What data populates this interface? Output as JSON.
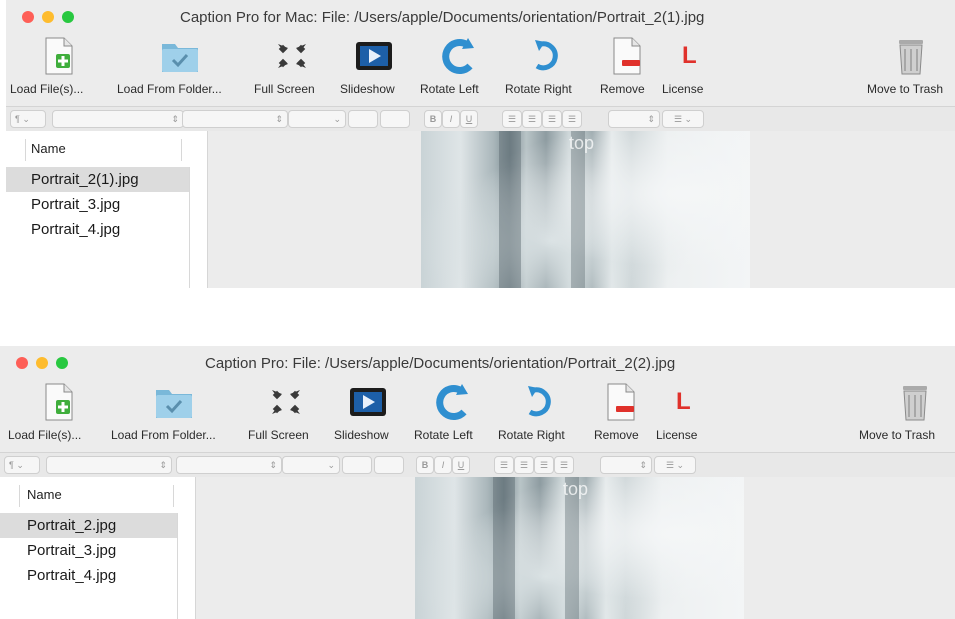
{
  "windows": [
    {
      "title": "Caption Pro for Mac: File: /Users/apple/Documents/orientation/Portrait_2(1).jpg",
      "toolbar": {
        "load_files": "Load File(s)...",
        "load_folder": "Load From Folder...",
        "full_screen": "Full Screen",
        "slideshow": "Slideshow",
        "rotate_left": "Rotate Left",
        "rotate_right": "Rotate Right",
        "remove": "Remove",
        "license": "License",
        "license_icon_letter": "L",
        "move_to_trash": "Move to Trash"
      },
      "file_list": {
        "header": "Name",
        "items": [
          "Portrait_2(1).jpg",
          "Portrait_3.jpg",
          "Portrait_4.jpg"
        ],
        "selected_index": 0
      },
      "preview_watermark": "top"
    },
    {
      "title": "Caption Pro: File: /Users/apple/Documents/orientation/Portrait_2(2).jpg",
      "toolbar": {
        "load_files": "Load File(s)...",
        "load_folder": "Load From Folder...",
        "full_screen": "Full Screen",
        "slideshow": "Slideshow",
        "rotate_left": "Rotate Left",
        "rotate_right": "Rotate Right",
        "remove": "Remove",
        "license": "License",
        "license_icon_letter": "L",
        "move_to_trash": "Move to Trash"
      },
      "file_list": {
        "header": "Name",
        "items": [
          "Portrait_2.jpg",
          "Portrait_3.jpg",
          "Portrait_4.jpg"
        ],
        "selected_index": 0
      },
      "preview_watermark": "top"
    }
  ],
  "format_bar": {
    "paragraph_glyph": "¶",
    "bold": "B",
    "italic": "I",
    "underline": "U"
  },
  "colors": {
    "traffic_close": "#fe5f57",
    "traffic_min": "#febc2e",
    "traffic_max": "#28c840",
    "selection": "#dcdcdc",
    "license_red": "#e0312b"
  },
  "icons": [
    "add-file-icon",
    "folder-icon",
    "full-screen-icon",
    "slideshow-icon",
    "rotate-left-icon",
    "rotate-right-icon",
    "remove-file-icon",
    "trash-icon"
  ]
}
